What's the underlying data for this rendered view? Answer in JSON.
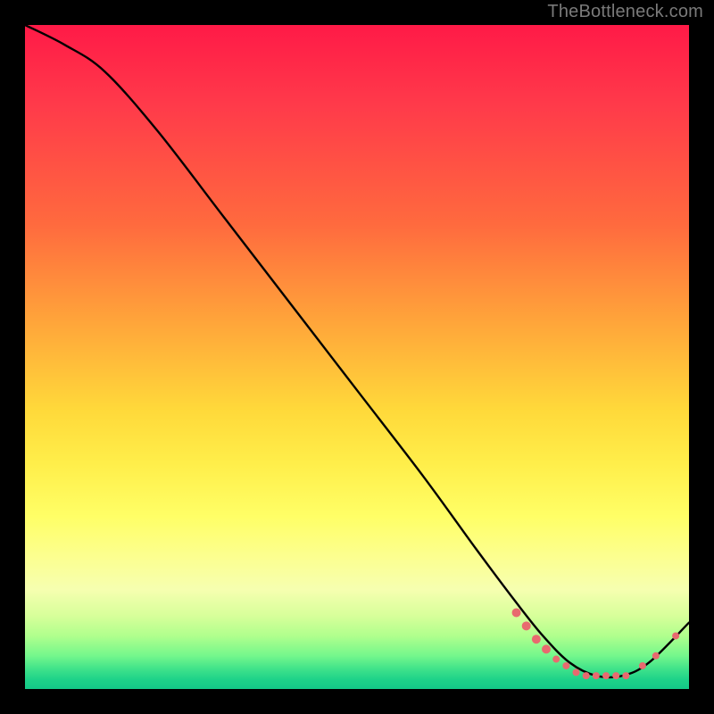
{
  "watermark": "TheBottleneck.com",
  "chart_data": {
    "type": "line",
    "title": "",
    "xlabel": "",
    "ylabel": "",
    "xlim": [
      0,
      100
    ],
    "ylim": [
      0,
      100
    ],
    "series": [
      {
        "name": "curve",
        "x": [
          0,
          6,
          12,
          20,
          30,
          40,
          50,
          60,
          68,
          74,
          78,
          82,
          86,
          90,
          94,
          100
        ],
        "y": [
          100,
          97,
          93,
          84,
          71,
          58,
          45,
          32,
          21,
          13,
          8,
          4,
          2,
          2,
          4,
          10
        ]
      }
    ],
    "markers": [
      {
        "x": 74.0,
        "y": 11.5,
        "r": 5
      },
      {
        "x": 75.5,
        "y": 9.5,
        "r": 5
      },
      {
        "x": 77.0,
        "y": 7.5,
        "r": 5
      },
      {
        "x": 78.5,
        "y": 6.0,
        "r": 5
      },
      {
        "x": 80.0,
        "y": 4.5,
        "r": 4
      },
      {
        "x": 81.5,
        "y": 3.5,
        "r": 4
      },
      {
        "x": 83.0,
        "y": 2.5,
        "r": 4
      },
      {
        "x": 84.5,
        "y": 2.0,
        "r": 4
      },
      {
        "x": 86.0,
        "y": 2.0,
        "r": 4
      },
      {
        "x": 87.5,
        "y": 2.0,
        "r": 4
      },
      {
        "x": 89.0,
        "y": 2.0,
        "r": 4
      },
      {
        "x": 90.5,
        "y": 2.0,
        "r": 4
      },
      {
        "x": 93.0,
        "y": 3.5,
        "r": 4
      },
      {
        "x": 95.0,
        "y": 5.0,
        "r": 4
      },
      {
        "x": 98.0,
        "y": 8.0,
        "r": 4
      }
    ],
    "colors": {
      "curve": "#000000",
      "marker": "#e86a6f"
    }
  }
}
